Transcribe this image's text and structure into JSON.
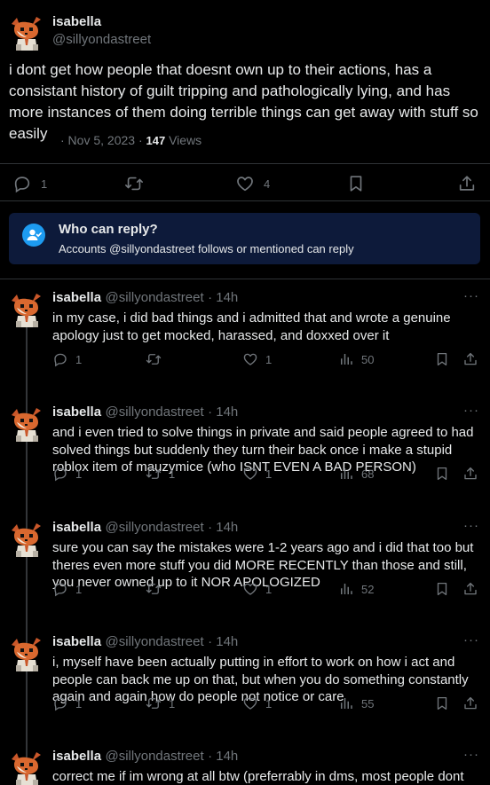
{
  "main_tweet": {
    "display_name": "isabella",
    "handle": "@sillyondastreet",
    "text": "i dont get how people that doesnt own up to their actions, has a consistant history of guilt tripping and pathologically lying, and has more instances of them doing terrible things can get away with stuff so easily",
    "date": "· Nov 5, 2023 ·",
    "views_count": "147",
    "views_label": "Views",
    "reply_count": "1",
    "like_count": "4"
  },
  "reply_restriction": {
    "title": "Who can reply?",
    "description": "Accounts @sillyondastreet follows or mentioned can reply",
    "banner_color": "#0d1a3a",
    "icon_color": "#1d9bf0"
  },
  "replies": [
    {
      "display_name": "isabella",
      "handle": "@sillyondastreet",
      "time": "· 14h",
      "text": "in my case, i did bad things and i admitted that and wrote a genuine apology just to get mocked, harassed, and doxxed over it",
      "reply_count": "1",
      "retweet_count": "",
      "like_count": "1",
      "views": "50"
    },
    {
      "display_name": "isabella",
      "handle": "@sillyondastreet",
      "time": "· 14h",
      "text": "and i even tried to solve things in private and said people agreed to had solved things but suddenly they turn their back once i make a stupid roblox item of mauzymice (who ISNT EVEN A BAD PERSON)",
      "reply_count": "1",
      "retweet_count": "1",
      "like_count": "1",
      "views": "68"
    },
    {
      "display_name": "isabella",
      "handle": "@sillyondastreet",
      "time": "· 14h",
      "text": "sure you can say the mistakes were 1-2 years ago and i did that too but theres even more stuff you did MORE RECENTLY than those and still, you never owned up to it NOR APOLOGIZED",
      "reply_count": "1",
      "retweet_count": "",
      "like_count": "1",
      "views": "52"
    },
    {
      "display_name": "isabella",
      "handle": "@sillyondastreet",
      "time": "· 14h",
      "text": "i, myself have been actually putting in effort to work on how i act and people can back me up on that, but when you do something constantly again and again how do people not notice or care",
      "reply_count": "1",
      "retweet_count": "1",
      "like_count": "1",
      "views": "55"
    },
    {
      "display_name": "isabella",
      "handle": "@sillyondastreet",
      "time": "· 14h",
      "text": "correct me if im wrong at all btw (preferrably in dms, most people dont care to read my tweets lol)"
    }
  ],
  "icons": {
    "reply": "reply-icon",
    "retweet": "retweet-icon",
    "like": "heart-icon",
    "views": "views-icon",
    "bookmark": "bookmark-icon",
    "share": "share-icon",
    "more": "more-icon"
  },
  "more_glyph": "···",
  "colors": {
    "accent": "#1d9bf0",
    "muted": "#71767b",
    "text": "#e7e9ea",
    "divider": "#2f3336"
  }
}
